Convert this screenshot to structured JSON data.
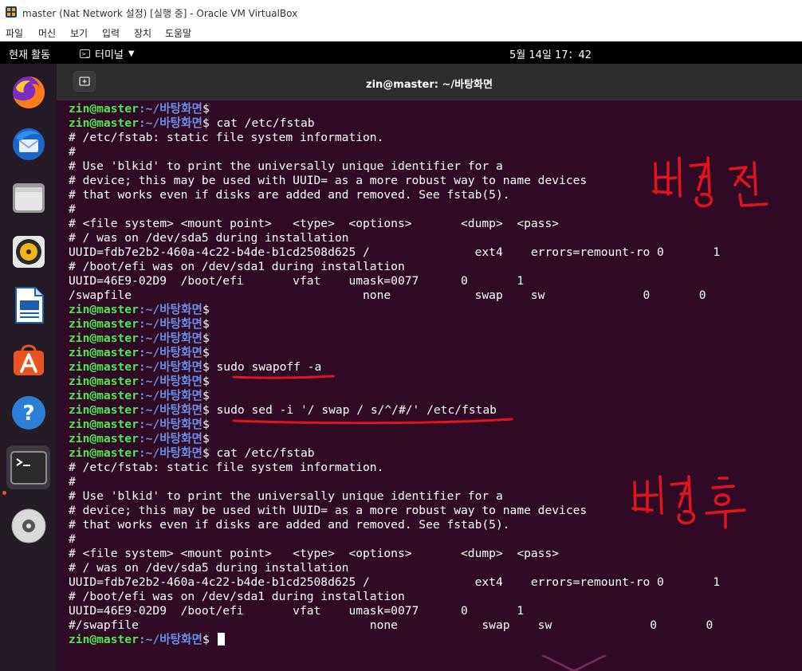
{
  "window": {
    "title": "master (Nat Network 설정) [실행 중] - Oracle VM VirtualBox"
  },
  "menu": [
    "파일",
    "머신",
    "보기",
    "입력",
    "장치",
    "도움말"
  ],
  "topbar": {
    "activities": "현재 활동",
    "app": "터미널",
    "clock": "5월 14일  17：42"
  },
  "dock": {
    "items": [
      "firefox-icon",
      "thunderbird-icon",
      "files-icon",
      "rhythmbox-icon",
      "libreoffice-writer-icon",
      "software-center-icon",
      "help-icon",
      "terminal-icon",
      "dvd-icon"
    ]
  },
  "terminal": {
    "title": "zin@master: ~/바탕화면",
    "prompt_user": "zin@master",
    "prompt_path": ":~/바탕화면",
    "lines": [
      {
        "p": true,
        "t": "$"
      },
      {
        "p": true,
        "t": "$ cat /etc/fstab"
      },
      {
        "p": false,
        "t": "# /etc/fstab: static file system information."
      },
      {
        "p": false,
        "t": "#"
      },
      {
        "p": false,
        "t": "# Use 'blkid' to print the universally unique identifier for a"
      },
      {
        "p": false,
        "t": "# device; this may be used with UUID= as a more robust way to name devices"
      },
      {
        "p": false,
        "t": "# that works even if disks are added and removed. See fstab(5)."
      },
      {
        "p": false,
        "t": "#"
      },
      {
        "p": false,
        "t": "# <file system> <mount point>   <type>  <options>       <dump>  <pass>"
      },
      {
        "p": false,
        "t": "# / was on /dev/sda5 during installation"
      },
      {
        "p": false,
        "t": "UUID=fdb7e2b2-460a-4c22-b4de-b1cd2508d625 /               ext4    errors=remount-ro 0       1"
      },
      {
        "p": false,
        "t": "# /boot/efi was on /dev/sda1 during installation"
      },
      {
        "p": false,
        "t": "UUID=46E9-02D9  /boot/efi       vfat    umask=0077      0       1"
      },
      {
        "p": false,
        "t": "/swapfile                                 none            swap    sw              0       0"
      },
      {
        "p": true,
        "t": "$"
      },
      {
        "p": true,
        "t": "$"
      },
      {
        "p": true,
        "t": "$"
      },
      {
        "p": true,
        "t": "$"
      },
      {
        "p": true,
        "t": "$ sudo swapoff -a"
      },
      {
        "p": true,
        "t": "$"
      },
      {
        "p": true,
        "t": "$"
      },
      {
        "p": true,
        "t": "$ sudo sed -i '/ swap / s/^/#/' /etc/fstab"
      },
      {
        "p": true,
        "t": "$"
      },
      {
        "p": true,
        "t": "$"
      },
      {
        "p": true,
        "t": "$ cat /etc/fstab"
      },
      {
        "p": false,
        "t": "# /etc/fstab: static file system information."
      },
      {
        "p": false,
        "t": "#"
      },
      {
        "p": false,
        "t": "# Use 'blkid' to print the universally unique identifier for a"
      },
      {
        "p": false,
        "t": "# device; this may be used with UUID= as a more robust way to name devices"
      },
      {
        "p": false,
        "t": "# that works even if disks are added and removed. See fstab(5)."
      },
      {
        "p": false,
        "t": "#"
      },
      {
        "p": false,
        "t": "# <file system> <mount point>   <type>  <options>       <dump>  <pass>"
      },
      {
        "p": false,
        "t": "# / was on /dev/sda5 during installation"
      },
      {
        "p": false,
        "t": "UUID=fdb7e2b2-460a-4c22-b4de-b1cd2508d625 /               ext4    errors=remount-ro 0       1"
      },
      {
        "p": false,
        "t": "# /boot/efi was on /dev/sda1 during installation"
      },
      {
        "p": false,
        "t": "UUID=46E9-02D9  /boot/efi       vfat    umask=0077      0       1"
      },
      {
        "p": false,
        "t": "#/swapfile                                 none            swap    sw              0       0"
      },
      {
        "p": true,
        "t": "$",
        "cursor": true
      }
    ]
  },
  "annotations": {
    "before": "변경전",
    "after": "변경후",
    "ink_color": "#e0141e"
  },
  "colors": {
    "terminal_bg": "#300a24",
    "prompt_user": "#4ee94e",
    "prompt_path": "#6a8fe6",
    "dock_bg": "#241b26",
    "accent": "#e95420"
  }
}
